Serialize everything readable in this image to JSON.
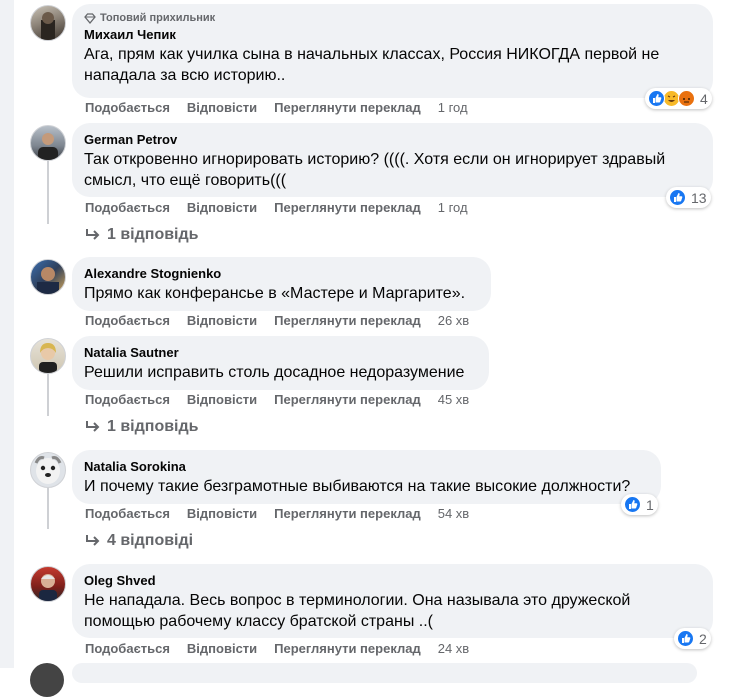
{
  "comments": [
    {
      "badge": "Топовий прихильник",
      "author": "Михаил Чепик",
      "text": "Ага, прям как училка сына в начальных классах, Россия НИКОГДА первой не нападала за всю историю..",
      "actions": {
        "like": "Подобається",
        "reply": "Відповісти",
        "translate": "Переглянути переклад",
        "time": "1 год"
      },
      "reaction_count": "4"
    },
    {
      "author": "German Petrov",
      "text": "Так откровенно игнорировать историю? ((((. Хотя если он игнорирует здравый смысл, что ещё говорить(((",
      "actions": {
        "like": "Подобається",
        "reply": "Відповісти",
        "translate": "Переглянути переклад",
        "time": "1 год"
      },
      "reaction_count": "13",
      "replies": "1 відповідь"
    },
    {
      "author": "Alexandre Stognienko",
      "text": "Прямо как конферансье в «Мастере и Маргарите».",
      "actions": {
        "like": "Подобається",
        "reply": "Відповісти",
        "translate": "Переглянути переклад",
        "time": "26 хв"
      }
    },
    {
      "author": "Natalia Sautner",
      "text": "Решили исправить столь досадное недоразумение",
      "actions": {
        "like": "Подобається",
        "reply": "Відповісти",
        "translate": "Переглянути переклад",
        "time": "45 хв"
      },
      "replies": "1 відповідь"
    },
    {
      "author": "Natalia Sorokina",
      "text": "И почему такие безграмотные выбиваются на такие высокие должности?",
      "actions": {
        "like": "Подобається",
        "reply": "Відповісти",
        "translate": "Переглянути переклад",
        "time": "54 хв"
      },
      "reaction_count": "1",
      "replies": "4 відповіді"
    },
    {
      "author": "Oleg Shved",
      "text": "Не нападала. Весь вопрос в терминологии. Она называла это дружеской помощью рабочему классу братской страны ..(",
      "actions": {
        "like": "Подобається",
        "reply": "Відповісти",
        "translate": "Переглянути переклад",
        "time": "24 хв"
      },
      "reaction_count": "2"
    }
  ],
  "colors": {
    "bubble": "#f0f2f5",
    "like": "#1877f2",
    "muted": "#65676b"
  },
  "icons": {
    "badge": "diamond-icon",
    "reply_arrow": "reply-arrow-icon"
  }
}
